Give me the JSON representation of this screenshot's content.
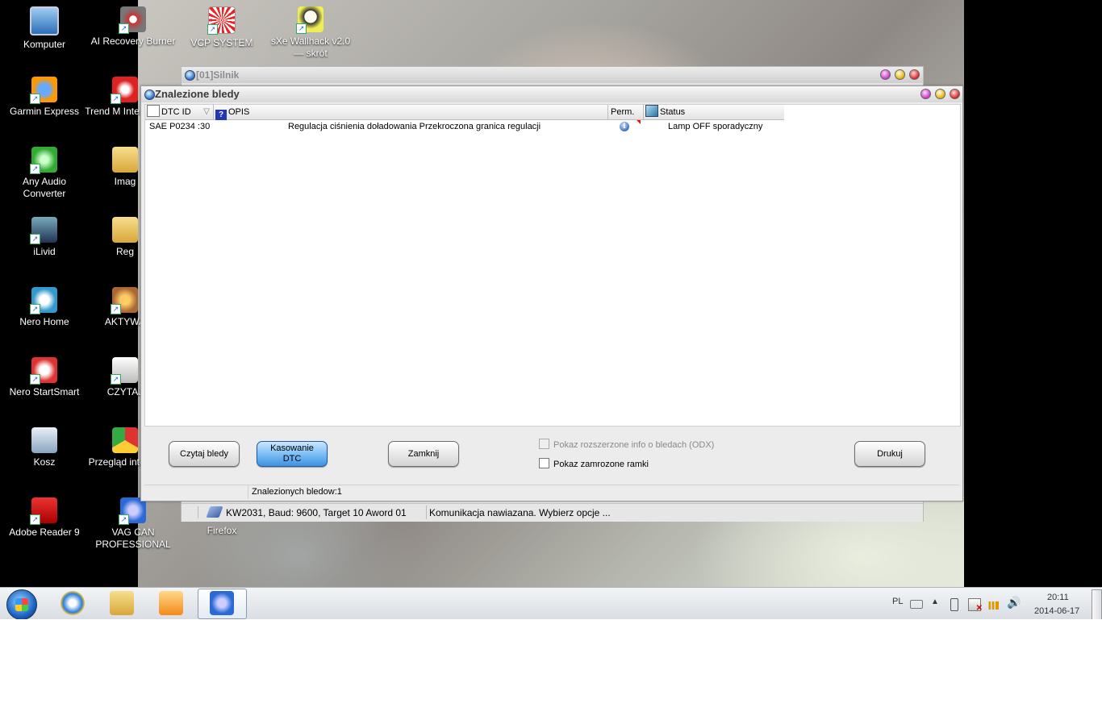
{
  "desktop": {
    "icons": [
      {
        "label": "Komputer",
        "icon": "computer-icon"
      },
      {
        "label": "AI Recovery Burner",
        "icon": "burner-icon"
      },
      {
        "label": "VCP SYSTEM",
        "icon": "vcp-icon"
      },
      {
        "label": "sXe Wallhack v2.0 — skrót",
        "icon": "skull-icon"
      },
      {
        "label": "Garmin Express",
        "icon": "garmin-icon"
      },
      {
        "label": "Trend M Internet S",
        "icon": "trend-icon"
      },
      {
        "label": "Any Audio Converter",
        "icon": "audio-converter-icon"
      },
      {
        "label": "Imag",
        "icon": "folder-icon"
      },
      {
        "label": "iLivid",
        "icon": "ilivid-icon"
      },
      {
        "label": "Reg",
        "icon": "folder-icon"
      },
      {
        "label": "Nero Home",
        "icon": "nero-home-icon"
      },
      {
        "label": "AKTYWA",
        "icon": "aktyw-icon"
      },
      {
        "label": "Nero StartSmart",
        "icon": "nero-startsmart-icon"
      },
      {
        "label": "CZYTAJ",
        "icon": "document-icon"
      },
      {
        "label": "Kosz",
        "icon": "recycle-bin-icon"
      },
      {
        "label": "Przegląd internet",
        "icon": "chrome-icon"
      },
      {
        "label": "Adobe Reader 9",
        "icon": "adobe-reader-icon"
      },
      {
        "label": "VAG CAN PROFESSIONAL",
        "icon": "vag-can-icon"
      },
      {
        "label": "Firefox",
        "icon": "firefox-icon"
      }
    ]
  },
  "background_window": {
    "title": "[01]Silnik",
    "status_connection": "KW2031, Baud: 9600, Target 10 Aword 01",
    "status_message": "Komunikacja nawiazana. Wybierz opcje ..."
  },
  "dialog": {
    "title": "Znalezione bledy",
    "columns": {
      "dtc_id": "DTC ID",
      "opis": "OPIS",
      "perm": "Perm.",
      "status": "Status"
    },
    "rows": [
      {
        "dtc_id": "SAE P0234 :30",
        "opis": "Regulacja ciśnienia doładowania Przekroczona granica regulacji",
        "perm": "info",
        "status": "Lamp OFF sporadyczny"
      }
    ],
    "buttons": {
      "read": "Czytaj bledy",
      "clear_line1": "Kasowanie",
      "clear_line2": "DTC",
      "close": "Zamknij",
      "print": "Drukuj"
    },
    "checkboxes": {
      "odx": "Pokaz rozszerzone info o bledach (ODX)",
      "freeze": "Pokaz zamrozone ramki"
    },
    "status_text": "Znalezionych bledow:1"
  },
  "taskbar": {
    "language": "PL",
    "time": "20:11",
    "date": "2014-06-17"
  }
}
